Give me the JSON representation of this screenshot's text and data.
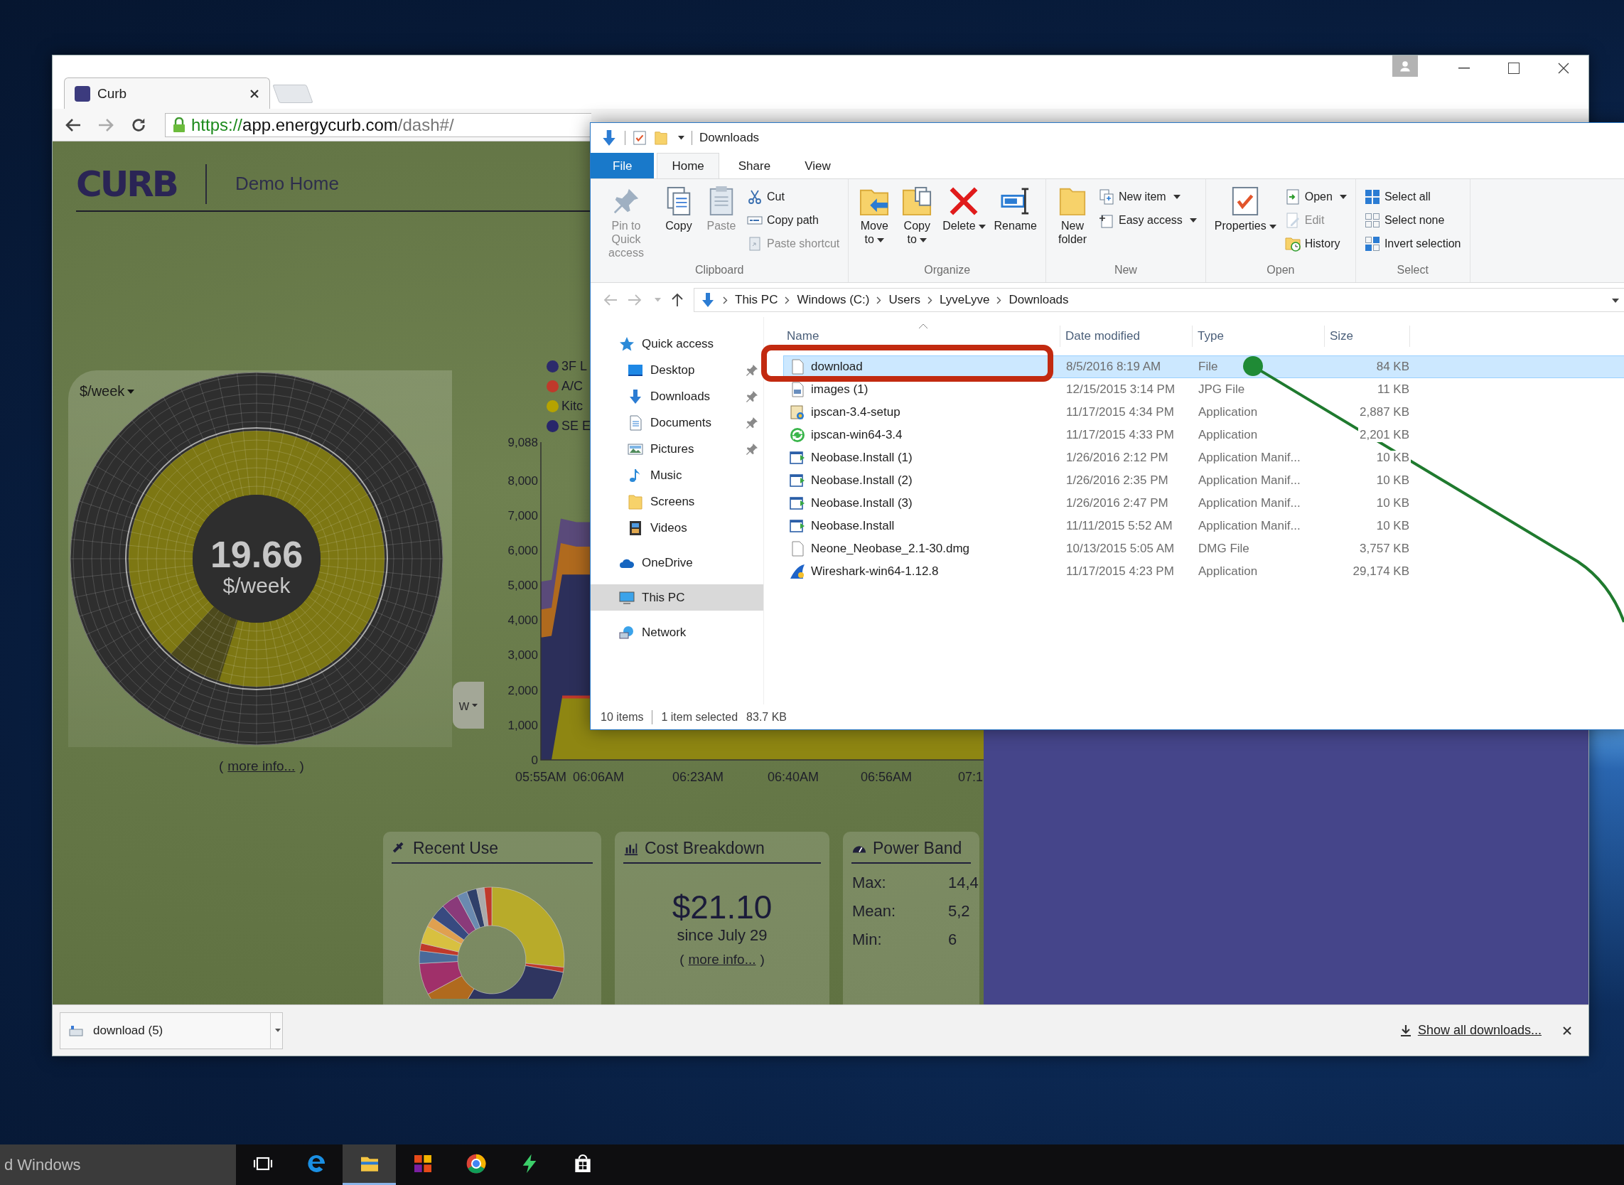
{
  "browser": {
    "tab": {
      "title": "Curb"
    },
    "url": {
      "scheme": "https://",
      "host": "app.energycurb.com",
      "path": "/dash#/"
    },
    "downloads": {
      "item": "download (5)",
      "show_all": "Show all downloads..."
    }
  },
  "curb": {
    "logo": "CURB",
    "home": "Demo Home",
    "gauge": {
      "period_select": "$/week",
      "value": "19.66",
      "unit": "$/week",
      "range_select": "w",
      "note": {
        "open": "(",
        "link": "more info...",
        "close": ")"
      }
    },
    "chart": {
      "legend": [
        {
          "label": "3F L",
          "color": "#2c2a6b"
        },
        {
          "label": "A/C",
          "color": "#c0392b"
        },
        {
          "label": "Kitc",
          "color": "#b5a300"
        },
        {
          "label": "SE E",
          "color": "#28266a"
        }
      ],
      "y_ticks": [
        "9,088",
        "8,000",
        "7,000",
        "6,000",
        "5,000",
        "4,000",
        "3,000",
        "2,000",
        "1,000",
        "0"
      ],
      "x_ticks": [
        "05:55AM",
        "06:06AM",
        "06:23AM",
        "06:40AM",
        "06:56AM",
        "07:1"
      ]
    },
    "cards": [
      {
        "kind": "recent",
        "title": "Recent Use"
      },
      {
        "kind": "cost",
        "title": "Cost Breakdown",
        "amount": "$21.10",
        "since": "since July 29",
        "note": {
          "open": "(",
          "link": "more info...",
          "close": ")"
        }
      },
      {
        "kind": "band",
        "title": "Power Band",
        "rows": [
          {
            "label": "Max:",
            "value": "14,4"
          },
          {
            "label": "Mean:",
            "value": "5,2"
          },
          {
            "label": "Min:",
            "value": "6"
          }
        ]
      }
    ]
  },
  "explorer": {
    "title": "Downloads",
    "tabs": [
      {
        "label": "File",
        "kind": "file",
        "selected": false
      },
      {
        "label": "Home",
        "kind": "tab",
        "selected": true
      },
      {
        "label": "Share",
        "kind": "tab",
        "selected": false
      },
      {
        "label": "View",
        "kind": "tab",
        "selected": false
      }
    ],
    "groups": [
      {
        "label": "Clipboard",
        "items": [
          {
            "kind": "large",
            "label": "Pin to Quick access",
            "disabled": true,
            "menu": false
          },
          {
            "kind": "large",
            "label": "Copy",
            "disabled": false,
            "menu": false
          },
          {
            "kind": "large",
            "label": "Paste",
            "disabled": true,
            "menu": false
          },
          {
            "kind": "stack",
            "items": [
              {
                "label": "Cut",
                "disabled": false,
                "menu": false
              },
              {
                "label": "Copy path",
                "disabled": false,
                "menu": false
              },
              {
                "label": "Paste shortcut",
                "disabled": true,
                "menu": false
              }
            ]
          }
        ]
      },
      {
        "label": "Organize",
        "items": [
          {
            "kind": "large",
            "label": "Move to",
            "disabled": false,
            "menu": true
          },
          {
            "kind": "large",
            "label": "Copy to",
            "disabled": false,
            "menu": true
          },
          {
            "kind": "large",
            "label": "Delete",
            "disabled": false,
            "menu": true
          },
          {
            "kind": "large",
            "label": "Rename",
            "disabled": false,
            "menu": false
          }
        ]
      },
      {
        "label": "New",
        "items": [
          {
            "kind": "large",
            "label": "New folder",
            "disabled": false,
            "menu": false
          },
          {
            "kind": "stack",
            "items": [
              {
                "label": "New item",
                "disabled": false,
                "menu": true
              },
              {
                "label": "Easy access",
                "disabled": false,
                "menu": true
              }
            ]
          }
        ]
      },
      {
        "label": "Open",
        "items": [
          {
            "kind": "large",
            "label": "Properties",
            "disabled": false,
            "menu": true
          },
          {
            "kind": "stack",
            "items": [
              {
                "label": "Open",
                "disabled": false,
                "menu": true
              },
              {
                "label": "Edit",
                "disabled": true,
                "menu": false
              },
              {
                "label": "History",
                "disabled": false,
                "menu": false
              }
            ]
          }
        ]
      },
      {
        "label": "Select",
        "items": [
          {
            "kind": "stack",
            "items": [
              {
                "label": "Select all",
                "disabled": false,
                "menu": false
              },
              {
                "label": "Select none",
                "disabled": false,
                "menu": false
              },
              {
                "label": "Invert selection",
                "disabled": false,
                "menu": false
              }
            ]
          }
        ]
      }
    ],
    "path": [
      "This PC",
      "Windows (C:)",
      "Users",
      "LyveLyve",
      "Downloads"
    ],
    "nav": [
      {
        "label": "Quick access",
        "selected": false,
        "children": [
          {
            "label": "Desktop",
            "pinned": true,
            "selected": false
          },
          {
            "label": "Downloads",
            "pinned": true,
            "selected": false
          },
          {
            "label": "Documents",
            "pinned": true,
            "selected": false
          },
          {
            "label": "Pictures",
            "pinned": true,
            "selected": false
          },
          {
            "label": "Music",
            "pinned": false,
            "selected": false
          },
          {
            "label": "Screens",
            "pinned": false,
            "selected": false
          },
          {
            "label": "Videos",
            "pinned": false,
            "selected": false
          }
        ]
      },
      {
        "label": "OneDrive",
        "selected": false
      },
      {
        "label": "This PC",
        "selected": true
      },
      {
        "label": "Network",
        "selected": false
      }
    ],
    "columns": [
      "Name",
      "Date modified",
      "Type",
      "Size"
    ],
    "files": [
      {
        "name": "download",
        "date": "8/5/2016 8:19 AM",
        "type": "File",
        "size": "84 KB",
        "selected": true
      },
      {
        "name": "images (1)",
        "date": "12/15/2015 3:14 PM",
        "type": "JPG File",
        "size": "11 KB",
        "selected": false
      },
      {
        "name": "ipscan-3.4-setup",
        "date": "11/17/2015 4:34 PM",
        "type": "Application",
        "size": "2,887 KB",
        "selected": false
      },
      {
        "name": "ipscan-win64-3.4",
        "date": "11/17/2015 4:33 PM",
        "type": "Application",
        "size": "2,201 KB",
        "selected": false
      },
      {
        "name": "Neobase.Install (1)",
        "date": "1/26/2016 2:12 PM",
        "type": "Application Manif...",
        "size": "10 KB",
        "selected": false
      },
      {
        "name": "Neobase.Install (2)",
        "date": "1/26/2016 2:35 PM",
        "type": "Application Manif...",
        "size": "10 KB",
        "selected": false
      },
      {
        "name": "Neobase.Install (3)",
        "date": "1/26/2016 2:47 PM",
        "type": "Application Manif...",
        "size": "10 KB",
        "selected": false
      },
      {
        "name": "Neobase.Install",
        "date": "11/11/2015 5:52 AM",
        "type": "Application Manif...",
        "size": "10 KB",
        "selected": false
      },
      {
        "name": "Neone_Neobase_2.1-30.dmg",
        "date": "10/13/2015 5:05 AM",
        "type": "DMG File",
        "size": "3,757 KB",
        "selected": false
      },
      {
        "name": "Wireshark-win64-1.12.8",
        "date": "11/17/2015 4:23 PM",
        "type": "Application",
        "size": "29,174 KB",
        "selected": false
      }
    ],
    "status": {
      "count": "10 items",
      "selection": "1 item selected",
      "size": "83.7 KB"
    }
  },
  "taskbar": {
    "search_text": "d Windows",
    "apps": [
      {
        "kind": "taskview",
        "selected": false
      },
      {
        "kind": "edge",
        "selected": false
      },
      {
        "kind": "explorer",
        "selected": true
      },
      {
        "kind": "office",
        "selected": false
      },
      {
        "kind": "chrome",
        "selected": false
      },
      {
        "kind": "bolt",
        "selected": false
      },
      {
        "kind": "store",
        "selected": false
      }
    ]
  }
}
